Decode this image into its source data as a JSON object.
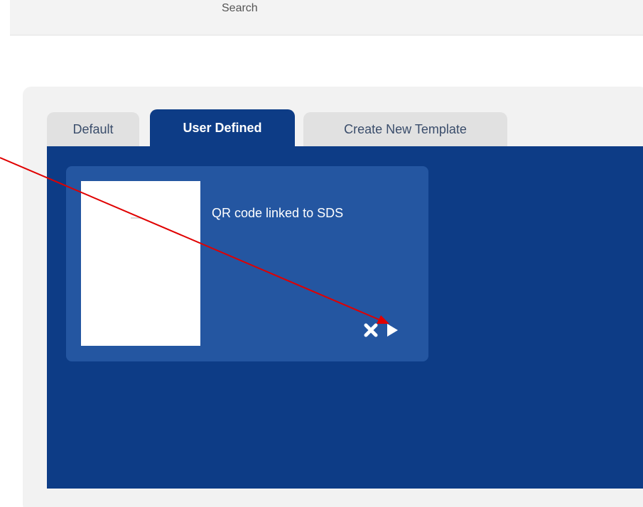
{
  "search": {
    "label": "Search"
  },
  "tabs": [
    {
      "label": "Default",
      "active": false
    },
    {
      "label": "User Defined",
      "active": true
    },
    {
      "label": "Create New Template",
      "active": false
    }
  ],
  "template_card": {
    "title": "QR code linked to SDS",
    "delete_icon": "close-icon",
    "run_icon": "play-icon"
  },
  "annotation": {
    "type": "arrow",
    "color": "#e00000"
  },
  "colors": {
    "content_blue": "#0d3c86",
    "card_blue": "#2456a1",
    "tab_inactive": "#e1e1e1",
    "panel_grey": "#f2f2f2"
  }
}
